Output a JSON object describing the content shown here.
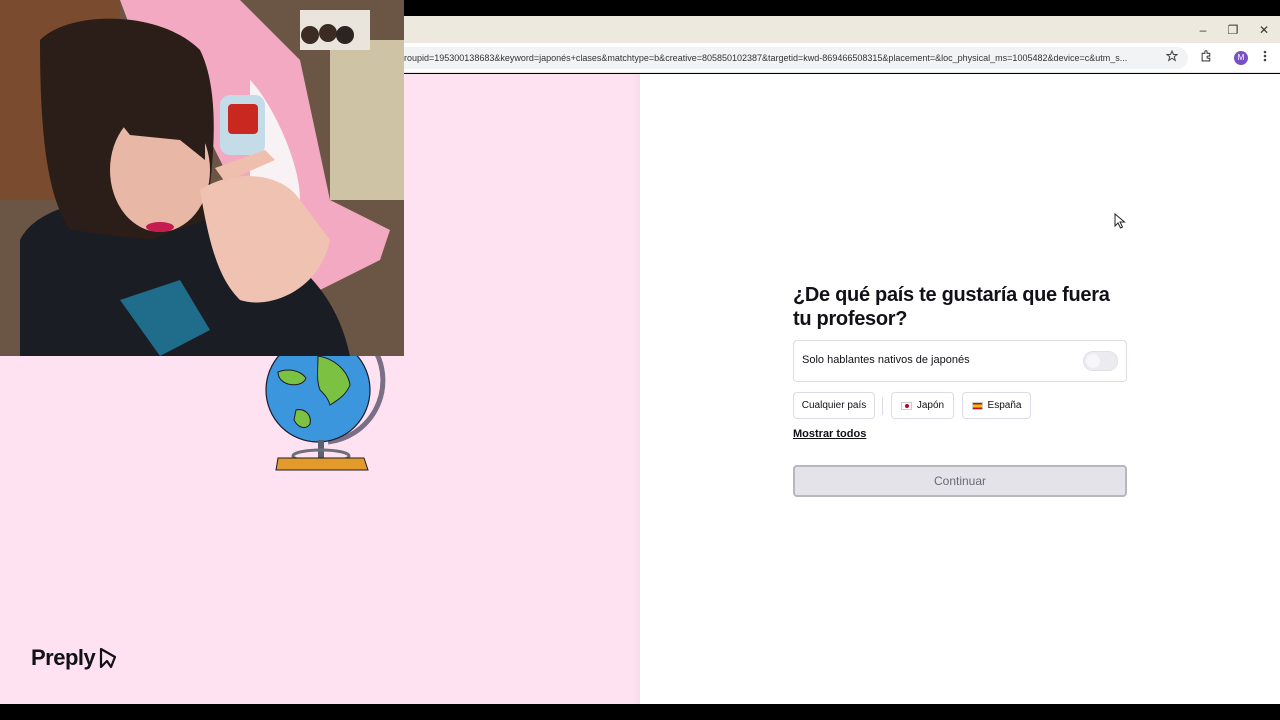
{
  "browser": {
    "url": "roupid=195300138683&keyword=japonés+clases&matchtype=b&creative=805850102387&targetid=kwd-869466508315&placement=&loc_physical_ms=1005482&device=c&utm_s...",
    "avatar_initial": "M",
    "controls": {
      "minimize": "–",
      "restore": "❐",
      "close": "✕"
    }
  },
  "brand": {
    "name": "Preply",
    "accent": "#ff2f7a",
    "left_bg": "#ffe2f1"
  },
  "question": {
    "title": "¿De qué país te gustaría que fuera tu profesor?",
    "toggle_label": "Solo hablantes nativos de japonés",
    "toggle_on": false
  },
  "chips": [
    {
      "label": "Cualquier país"
    },
    {
      "label": "Japón",
      "flag": "jp-flag-icon"
    },
    {
      "label": "España",
      "flag": "es-flag-icon"
    }
  ],
  "show_all": "Mostrar todos",
  "continue_label": "Continuar"
}
